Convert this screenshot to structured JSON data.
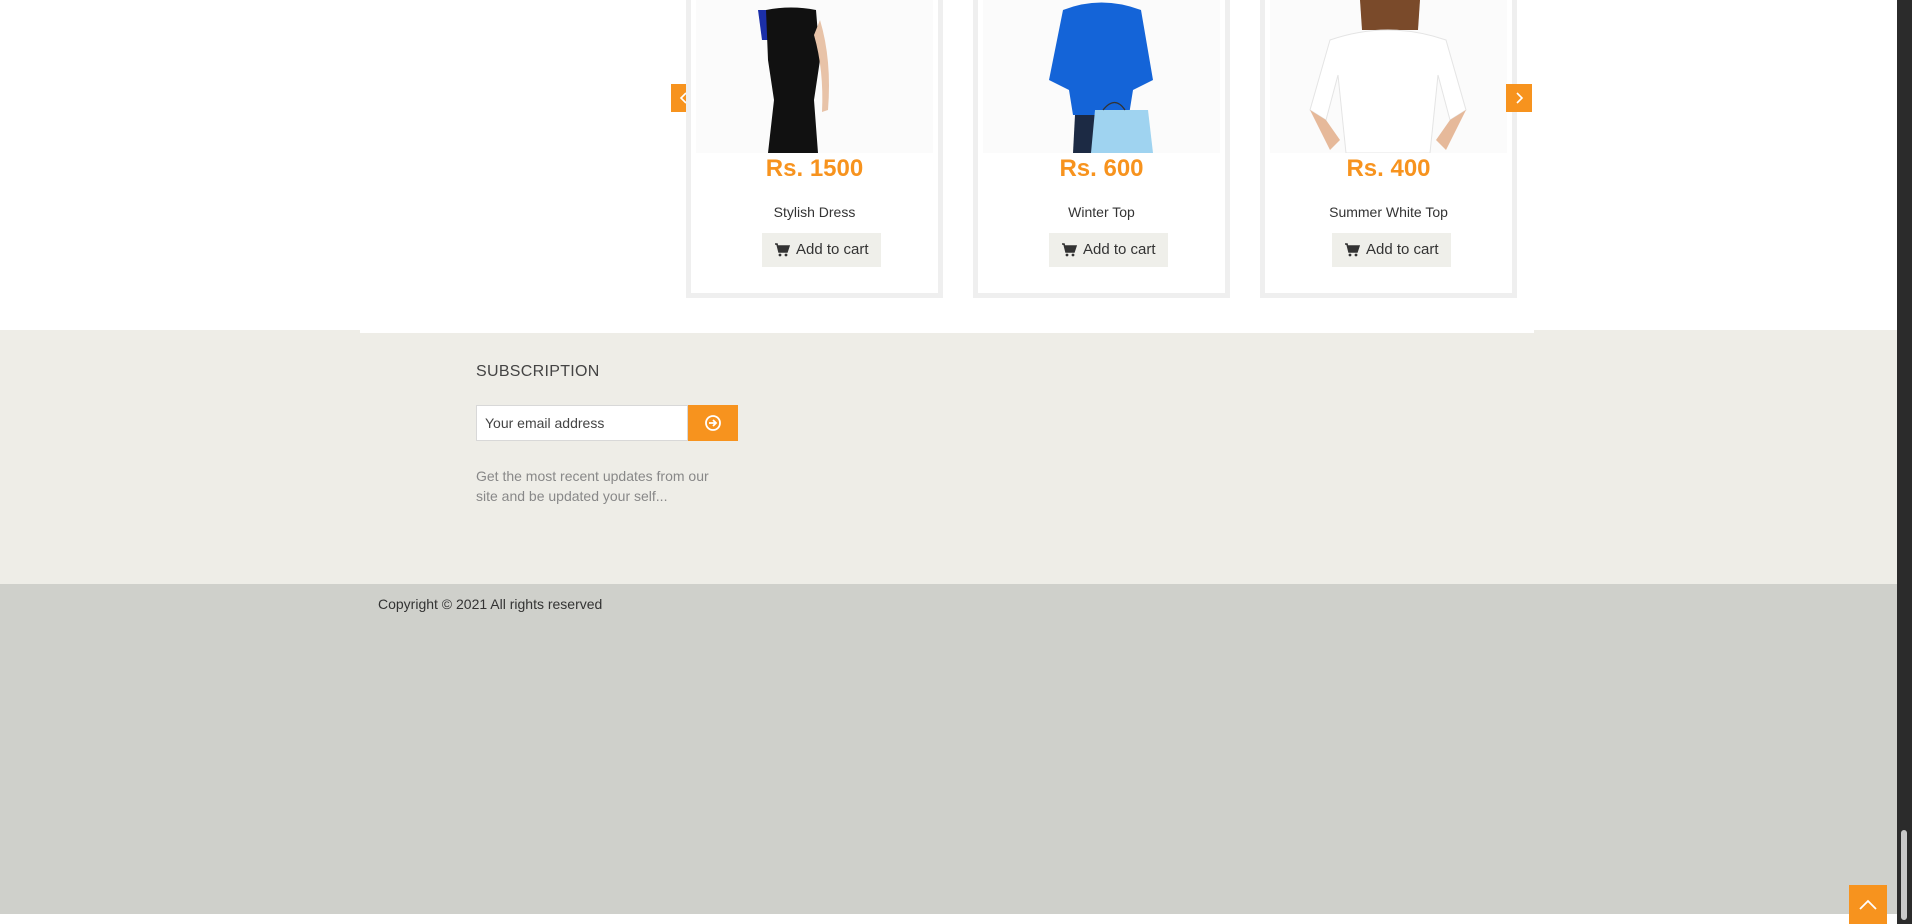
{
  "products": [
    {
      "price": "Rs. 1500",
      "title": "Stylish Dress",
      "cart_label": "Add to cart"
    },
    {
      "price": "Rs. 600",
      "title": "Winter Top",
      "cart_label": "Add to cart"
    },
    {
      "price": "Rs. 400",
      "title": "Summer White Top",
      "cart_label": "Add to cart"
    }
  ],
  "carousel": {
    "prev_icon": "chevron-left-icon",
    "next_icon": "chevron-right-icon"
  },
  "subscription": {
    "title": "SUBSCRIPTION",
    "email_placeholder": "Your email address",
    "email_value": "",
    "submit_icon": "arrow-circle-right-icon",
    "description": "Get the most recent updates from our site and be updated your self..."
  },
  "footer": {
    "copyright": "Copyright © 2021 All rights reserved"
  },
  "colors": {
    "accent": "#f7931e",
    "subscription_bg": "#eeede7",
    "copyright_bg": "#cfd0cb"
  }
}
